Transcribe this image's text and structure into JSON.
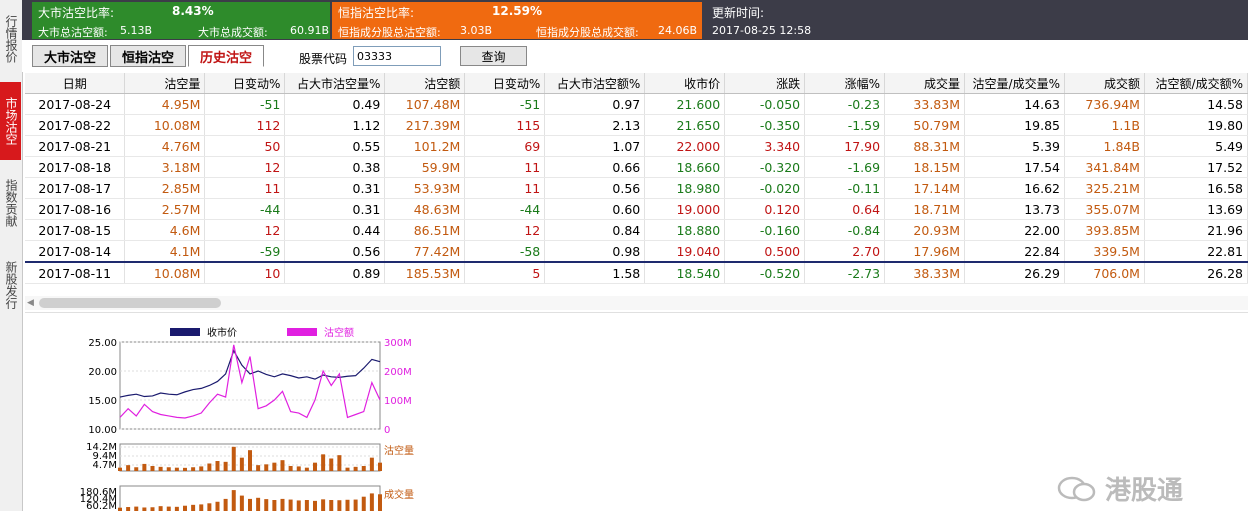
{
  "side_tabs": [
    {
      "label": "行情报价"
    },
    {
      "label": "市场沽空"
    },
    {
      "label": "指数贡献"
    },
    {
      "label": "新股发行"
    }
  ],
  "header": {
    "market_short_ratio_label": "大市沽空比率:",
    "market_short_ratio_value": "8.43%",
    "market_short_amount_label": "大市总沽空额:",
    "market_short_amount_value": "5.13B",
    "market_turnover_label": "大市总成交额:",
    "market_turnover_value": "60.91B",
    "hsi_short_ratio_label": "恒指沽空比率:",
    "hsi_short_ratio_value": "12.59%",
    "hsi_short_amount_label": "恒指成分股总沽空额:",
    "hsi_short_amount_value": "3.03B",
    "hsi_turnover_label": "恒指成分股总成交额:",
    "hsi_turnover_value": "24.06B",
    "update_label": "更新时间:",
    "update_value": "2017-08-25 12:58"
  },
  "toolbar": {
    "tab_market": "大市沽空",
    "tab_hsi": "恒指沽空",
    "tab_history": "历史沽空",
    "code_label": "股票代码",
    "code_value": "03333",
    "query_label": "查询"
  },
  "table": {
    "columns": [
      "日期",
      "沽空量",
      "日变动%",
      "占大市沽空量%",
      "沽空额",
      "日变动%",
      "占大市沽空额%",
      "收市价",
      "涨跌",
      "涨幅%",
      "成交量",
      "沽空量/成交量%",
      "成交额",
      "沽空额/成交额%"
    ],
    "rows": [
      [
        "2017-08-24",
        "4.95M",
        "-51",
        "0.49",
        "107.48M",
        "-51",
        "0.97",
        "21.600",
        "-0.050",
        "-0.23",
        "33.83M",
        "14.63",
        "736.94M",
        "14.58"
      ],
      [
        "2017-08-22",
        "10.08M",
        "112",
        "1.12",
        "217.39M",
        "115",
        "2.13",
        "21.650",
        "-0.350",
        "-1.59",
        "50.79M",
        "19.85",
        "1.1B",
        "19.80"
      ],
      [
        "2017-08-21",
        "4.76M",
        "50",
        "0.55",
        "101.2M",
        "69",
        "1.07",
        "22.000",
        "3.340",
        "17.90",
        "88.31M",
        "5.39",
        "1.84B",
        "5.49"
      ],
      [
        "2017-08-18",
        "3.18M",
        "12",
        "0.38",
        "59.9M",
        "11",
        "0.66",
        "18.660",
        "-0.320",
        "-1.69",
        "18.15M",
        "17.54",
        "341.84M",
        "17.52"
      ],
      [
        "2017-08-17",
        "2.85M",
        "11",
        "0.31",
        "53.93M",
        "11",
        "0.56",
        "18.980",
        "-0.020",
        "-0.11",
        "17.14M",
        "16.62",
        "325.21M",
        "16.58"
      ],
      [
        "2017-08-16",
        "2.57M",
        "-44",
        "0.31",
        "48.63M",
        "-44",
        "0.60",
        "19.000",
        "0.120",
        "0.64",
        "18.71M",
        "13.73",
        "355.07M",
        "13.69"
      ],
      [
        "2017-08-15",
        "4.6M",
        "12",
        "0.44",
        "86.51M",
        "12",
        "0.84",
        "18.880",
        "-0.160",
        "-0.84",
        "20.93M",
        "22.00",
        "393.85M",
        "21.96"
      ],
      [
        "2017-08-14",
        "4.1M",
        "-59",
        "0.56",
        "77.42M",
        "-58",
        "0.98",
        "19.040",
        "0.500",
        "2.70",
        "17.96M",
        "22.84",
        "339.5M",
        "22.81"
      ],
      [
        "2017-08-11",
        "10.08M",
        "10",
        "0.89",
        "185.53M",
        "5",
        "1.58",
        "18.540",
        "-0.520",
        "-2.73",
        "38.33M",
        "26.29",
        "706.0M",
        "26.28"
      ]
    ]
  },
  "chart_data": {
    "type": "line",
    "legend": [
      "收市价",
      "沽空额"
    ],
    "colors": {
      "close": "#1a1a6e",
      "short": "#e020e0",
      "bar": "#c25a10"
    },
    "left_axis": {
      "ticks": [
        "25.00",
        "20.00",
        "15.00",
        "10.00"
      ],
      "range": [
        10,
        25
      ]
    },
    "right_axis": {
      "ticks": [
        "300M",
        "200M",
        "100M",
        "0"
      ],
      "range": [
        0,
        300
      ]
    },
    "close_price": [
      15.5,
      15.8,
      16.0,
      15.6,
      15.7,
      16.2,
      16.0,
      15.9,
      16.4,
      16.8,
      17.0,
      17.5,
      18.2,
      19.5,
      23.5,
      21.0,
      19.5,
      20.0,
      19.4,
      19.0,
      19.5,
      19.2,
      18.8,
      19.0,
      18.6,
      19.3,
      19.0,
      18.9,
      19.1,
      19.2,
      20.5,
      22.0,
      21.6
    ],
    "short_amount": [
      40,
      70,
      45,
      85,
      60,
      50,
      45,
      40,
      38,
      45,
      55,
      90,
      120,
      110,
      290,
      160,
      250,
      70,
      80,
      100,
      130,
      60,
      55,
      40,
      100,
      200,
      150,
      190,
      40,
      50,
      60,
      160,
      100
    ],
    "short_volume_panel": {
      "label": "沽空量",
      "ticks": [
        "14.2M",
        "9.4M",
        "4.7M"
      ]
    },
    "turnover_panel": {
      "label": "成交量",
      "ticks": [
        "180.6M",
        "120.4M",
        "60.2M"
      ]
    }
  },
  "watermark": "港股通"
}
